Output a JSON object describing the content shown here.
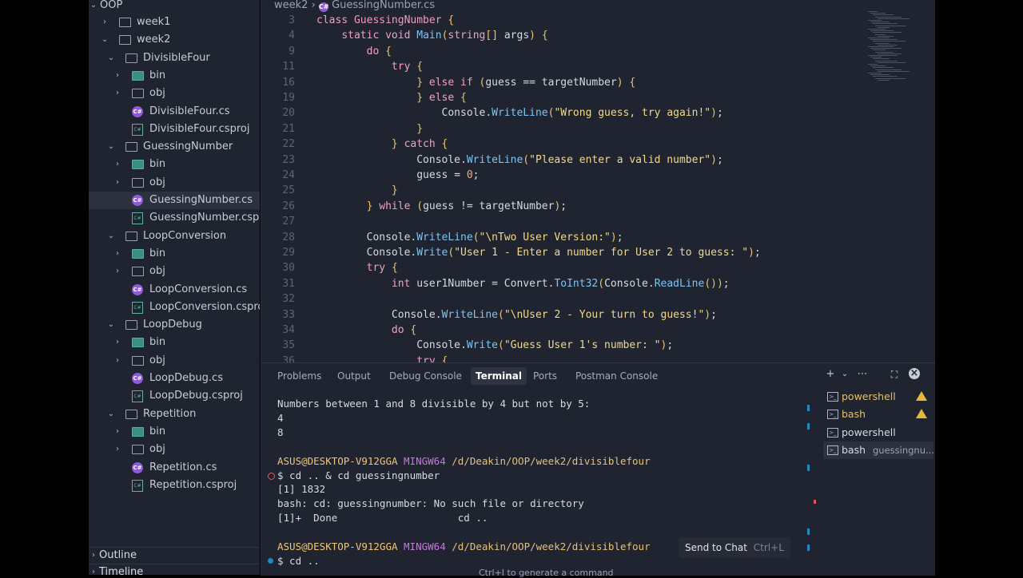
{
  "sidebar": {
    "root": "OOP",
    "items": [
      {
        "label": "week1",
        "kind": "folder",
        "chev": "›"
      },
      {
        "label": "week2",
        "kind": "folder",
        "chev": "⌄"
      },
      {
        "label": "DivisibleFour",
        "kind": "folder",
        "chev": "⌄"
      },
      {
        "label": "bin",
        "kind": "bin",
        "chev": "›"
      },
      {
        "label": "obj",
        "kind": "obj",
        "chev": "›"
      },
      {
        "label": "DivisibleFour.cs",
        "kind": "cs"
      },
      {
        "label": "DivisibleFour.csproj",
        "kind": "proj"
      },
      {
        "label": "GuessingNumber",
        "kind": "folder",
        "chev": "⌄"
      },
      {
        "label": "bin",
        "kind": "bin",
        "chev": "›"
      },
      {
        "label": "obj",
        "kind": "obj",
        "chev": "›"
      },
      {
        "label": "GuessingNumber.cs",
        "kind": "cs",
        "selected": true
      },
      {
        "label": "GuessingNumber.csproj",
        "kind": "proj"
      },
      {
        "label": "LoopConversion",
        "kind": "folder",
        "chev": "⌄"
      },
      {
        "label": "bin",
        "kind": "bin",
        "chev": "›"
      },
      {
        "label": "obj",
        "kind": "obj",
        "chev": "›"
      },
      {
        "label": "LoopConversion.cs",
        "kind": "cs"
      },
      {
        "label": "LoopConversion.csproj",
        "kind": "proj"
      },
      {
        "label": "LoopDebug",
        "kind": "folder",
        "chev": "⌄"
      },
      {
        "label": "bin",
        "kind": "bin",
        "chev": "›"
      },
      {
        "label": "obj",
        "kind": "obj",
        "chev": "›"
      },
      {
        "label": "LoopDebug.cs",
        "kind": "cs"
      },
      {
        "label": "LoopDebug.csproj",
        "kind": "proj"
      },
      {
        "label": "Repetition",
        "kind": "folder",
        "chev": "⌄"
      },
      {
        "label": "bin",
        "kind": "bin",
        "chev": "›"
      },
      {
        "label": "obj",
        "kind": "obj",
        "chev": "›"
      },
      {
        "label": "Repetition.cs",
        "kind": "cs"
      },
      {
        "label": "Repetition.csproj",
        "kind": "proj"
      }
    ],
    "outline": "Outline",
    "timeline": "Timeline"
  },
  "editor": {
    "breadcrumb": [
      "week2",
      "›",
      "GuessingNumber.cs"
    ],
    "lines": [
      {
        "n": "3",
        "code": "class GuessingNumber {"
      },
      {
        "n": "4",
        "code": "    static void Main(string[] args) {"
      },
      {
        "n": "9",
        "code": "        do {"
      },
      {
        "n": "11",
        "code": "            try {"
      },
      {
        "n": "16",
        "code": "                } else if (guess == targetNumber) {"
      },
      {
        "n": "19",
        "code": "                } else {"
      },
      {
        "n": "20",
        "code": "                    Console.WriteLine(\"Wrong guess, try again!\");"
      },
      {
        "n": "21",
        "code": "                }"
      },
      {
        "n": "22",
        "code": "            } catch {"
      },
      {
        "n": "23",
        "code": "                Console.WriteLine(\"Please enter a valid number\");"
      },
      {
        "n": "24",
        "code": "                guess = 0;"
      },
      {
        "n": "25",
        "code": "            }"
      },
      {
        "n": "26",
        "code": "        } while (guess != targetNumber);"
      },
      {
        "n": "27",
        "code": ""
      },
      {
        "n": "28",
        "code": "        Console.WriteLine(\"\\nTwo User Version:\");"
      },
      {
        "n": "29",
        "code": "        Console.Write(\"User 1 - Enter a number for User 2 to guess: \");"
      },
      {
        "n": "30",
        "code": "        try {"
      },
      {
        "n": "31",
        "code": "            int user1Number = Convert.ToInt32(Console.ReadLine());"
      },
      {
        "n": "32",
        "code": ""
      },
      {
        "n": "33",
        "code": "            Console.WriteLine(\"\\nUser 2 - Your turn to guess!\");"
      },
      {
        "n": "34",
        "code": "            do {"
      },
      {
        "n": "35",
        "code": "                Console.Write(\"Guess User 1's number: \");"
      },
      {
        "n": "36",
        "code": "                try {"
      }
    ]
  },
  "panel": {
    "tabs": [
      "Problems",
      "Output",
      "Debug Console",
      "Terminal",
      "Ports",
      "Postman Console"
    ],
    "active_tab": "Terminal",
    "icons": {
      "add": "+",
      "chevron": "⌄",
      "more": "⋯",
      "maximize": "⛶",
      "close": "×"
    },
    "terminal_lines": [
      {
        "t": "Numbers between 1 and 8 divisible by 4 but not by 5:"
      },
      {
        "t": "4"
      },
      {
        "t": "8"
      },
      {
        "t": ""
      },
      {
        "prompt": true,
        "user": "ASUS@DESKTOP-V912GGA",
        "env": "MINGW64",
        "path": "/d/Deakin/OOP/week2/divisiblefour"
      },
      {
        "t": "$ cd .. & cd guessingnumber",
        "mark": "error"
      },
      {
        "t": "[1] 1832"
      },
      {
        "t": "bash: cd: guessingnumber: No such file or directory"
      },
      {
        "t": "[1]+  Done                    cd .."
      },
      {
        "t": ""
      },
      {
        "prompt": true,
        "user": "ASUS@DESKTOP-V912GGA",
        "env": "MINGW64",
        "path": "/d/Deakin/OOP/week2/divisiblefour"
      },
      {
        "t": "$ cd ..",
        "mark": "info"
      }
    ],
    "terminals": [
      {
        "label": "powershell",
        "warn": true
      },
      {
        "label": "bash",
        "warn": true
      },
      {
        "label": "powershell",
        "warn": false
      },
      {
        "label": "bash",
        "sub": "guessingnu...",
        "warn": false,
        "selected": true
      }
    ],
    "send_to_chat": {
      "label": "Send to Chat",
      "shortcut": "Ctrl+L"
    },
    "hint": "Ctrl+I to generate a command"
  },
  "colors": {
    "keyword": "#f0a0c8",
    "type": "#f29bbd",
    "method": "#7fc4f0",
    "string": "#f2d98a",
    "number": "#f5a97f",
    "accent": "#1e88c8",
    "warning": "#e2b93b"
  }
}
